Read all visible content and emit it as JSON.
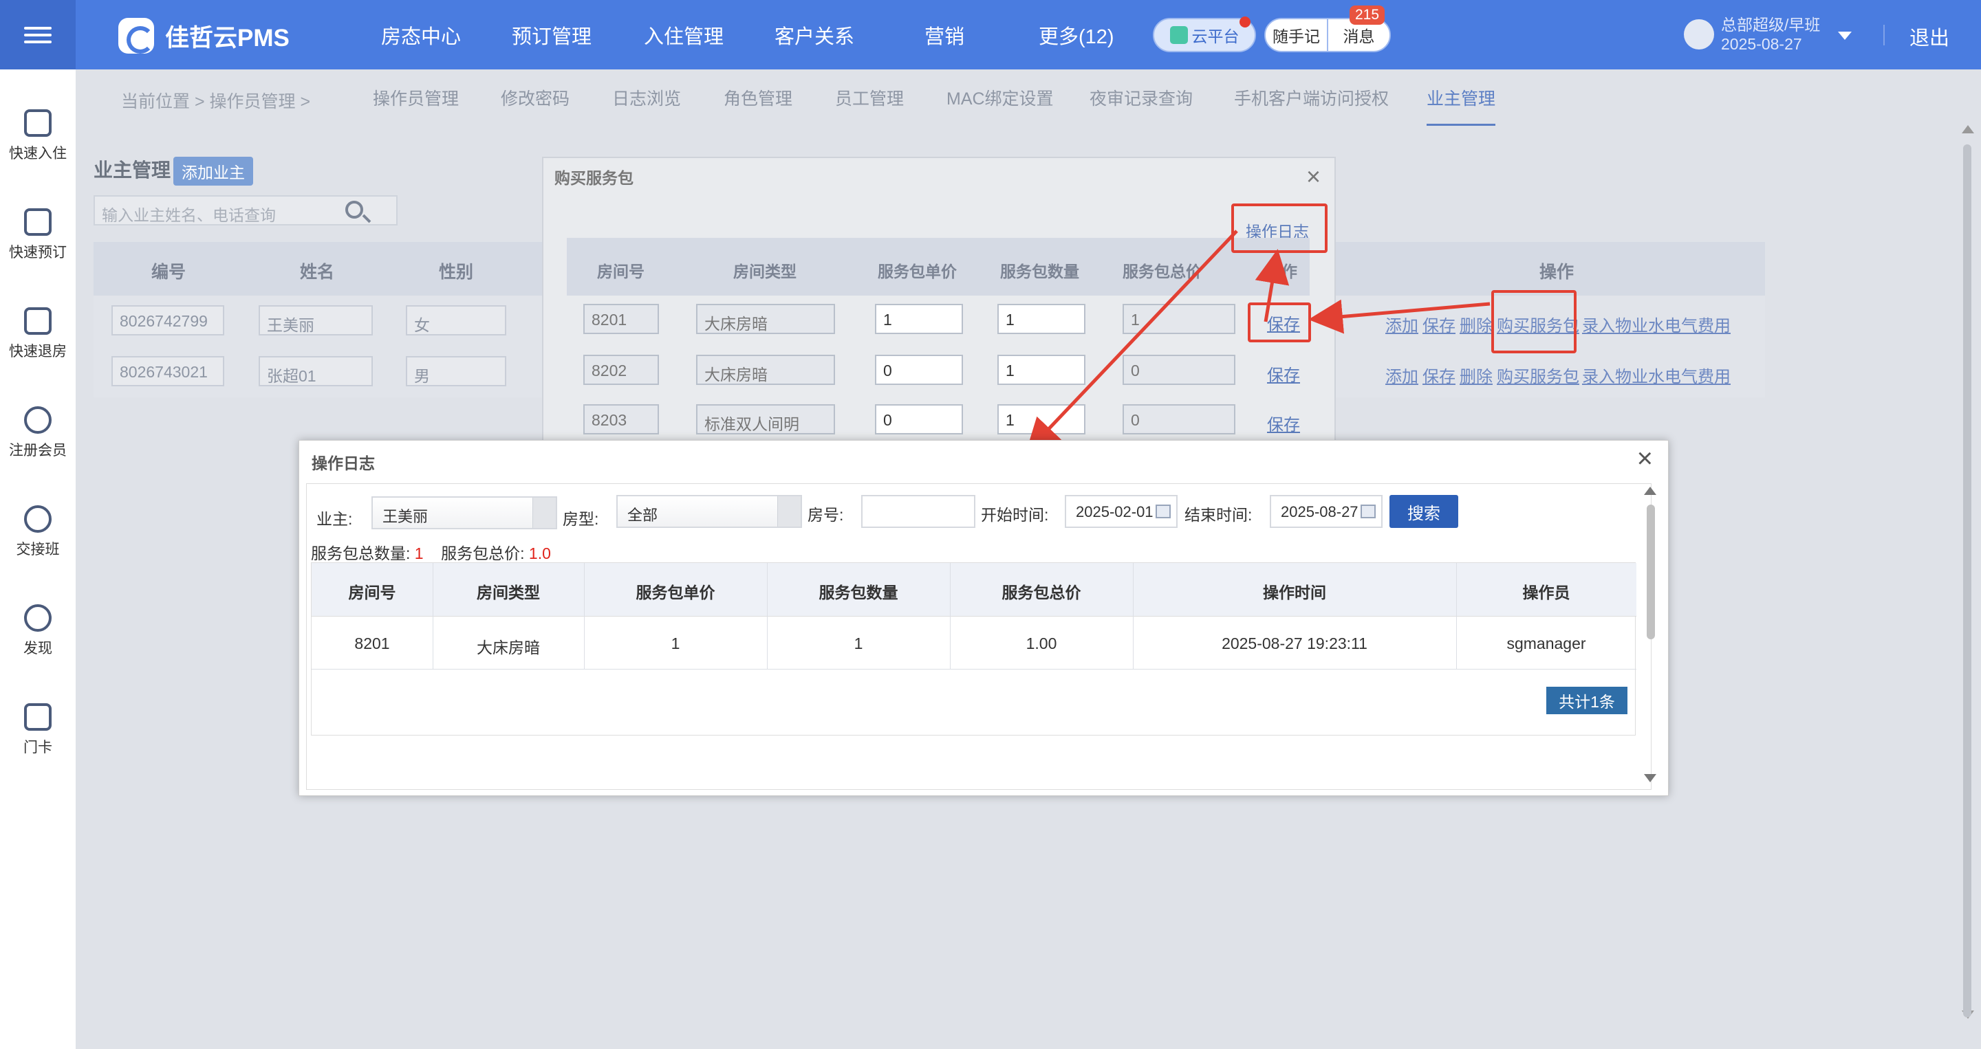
{
  "topbar": {
    "logo_text": "佳哲云PMS",
    "nav": [
      "房态中心",
      "预订管理",
      "入住管理",
      "客户关系",
      "营销",
      "更多(12)"
    ],
    "cloud_label": "云平台",
    "notes_label": "随手记",
    "messages_label": "消息",
    "messages_count": "215",
    "user_line1": "总部超级/早班",
    "user_line2": "2025-08-27",
    "logout": "退出",
    "accent_color": "#4a7ce0"
  },
  "sidebar": {
    "items": [
      {
        "label": "快速入住",
        "icon": "home-icon"
      },
      {
        "label": "快速预订",
        "icon": "clipboard-icon"
      },
      {
        "label": "快速退房",
        "icon": "checkout-icon"
      },
      {
        "label": "注册会员",
        "icon": "user-add-icon"
      },
      {
        "label": "交接班",
        "icon": "user-switch-icon"
      },
      {
        "label": "发现",
        "icon": "hand-coin-icon"
      },
      {
        "label": "门卡",
        "icon": "card-icon"
      }
    ]
  },
  "breadcrumb": "当前位置 > 操作员管理 >",
  "tabs": [
    "操作员管理",
    "修改密码",
    "日志浏览",
    "角色管理",
    "员工管理",
    "MAC绑定设置",
    "夜审记录查询",
    "手机客户端访问授权",
    "业主管理"
  ],
  "owner_page": {
    "title": "业主管理",
    "add_button": "添加业主",
    "search_placeholder": "输入业主姓名、电话查询",
    "headers": [
      "编号",
      "姓名",
      "性别",
      "操作"
    ],
    "rows": [
      {
        "id": "8026742799",
        "name": "王美丽",
        "gender": "女"
      },
      {
        "id": "8026743021",
        "name": "张超01",
        "gender": "男"
      }
    ],
    "actions": [
      "添加",
      "保存",
      "删除",
      "购买服务包",
      "录入物业水电气费用"
    ]
  },
  "buy_dialog": {
    "title": "购买服务包",
    "log_link": "操作日志",
    "headers": [
      "房间号",
      "房间类型",
      "服务包单价",
      "服务包数量",
      "服务包总价",
      "操作"
    ],
    "rows": [
      {
        "room": "8201",
        "type": "大床房暗",
        "price": "1",
        "qty": "1",
        "total": "1",
        "action": "保存"
      },
      {
        "room": "8202",
        "type": "大床房暗",
        "price": "0",
        "qty": "1",
        "total": "0",
        "action": "保存"
      },
      {
        "room": "8203",
        "type": "标准双人间明",
        "price": "0",
        "qty": "1",
        "total": "0",
        "action": "保存"
      }
    ]
  },
  "log_dialog": {
    "title": "操作日志",
    "owner_label": "业主:",
    "owner_value": "王美丽",
    "roomtype_label": "房型:",
    "roomtype_value": "全部",
    "room_label": "房号:",
    "room_value": "",
    "start_label": "开始时间:",
    "start_value": "2025-02-01",
    "end_label": "结束时间:",
    "end_value": "2025-08-27",
    "search_button": "搜索",
    "sum_qty_label": "服务包总数量:",
    "sum_qty_value": "1",
    "sum_price_label": "服务包总价:",
    "sum_price_value": "1.0",
    "headers": [
      "房间号",
      "房间类型",
      "服务包单价",
      "服务包数量",
      "服务包总价",
      "操作时间",
      "操作员"
    ],
    "rows": [
      {
        "room": "8201",
        "type": "大床房暗",
        "price": "1",
        "qty": "1",
        "total": "1.00",
        "time": "2025-08-27 19:23:11",
        "operator": "sgmanager"
      }
    ],
    "total_label": "共计1条"
  }
}
